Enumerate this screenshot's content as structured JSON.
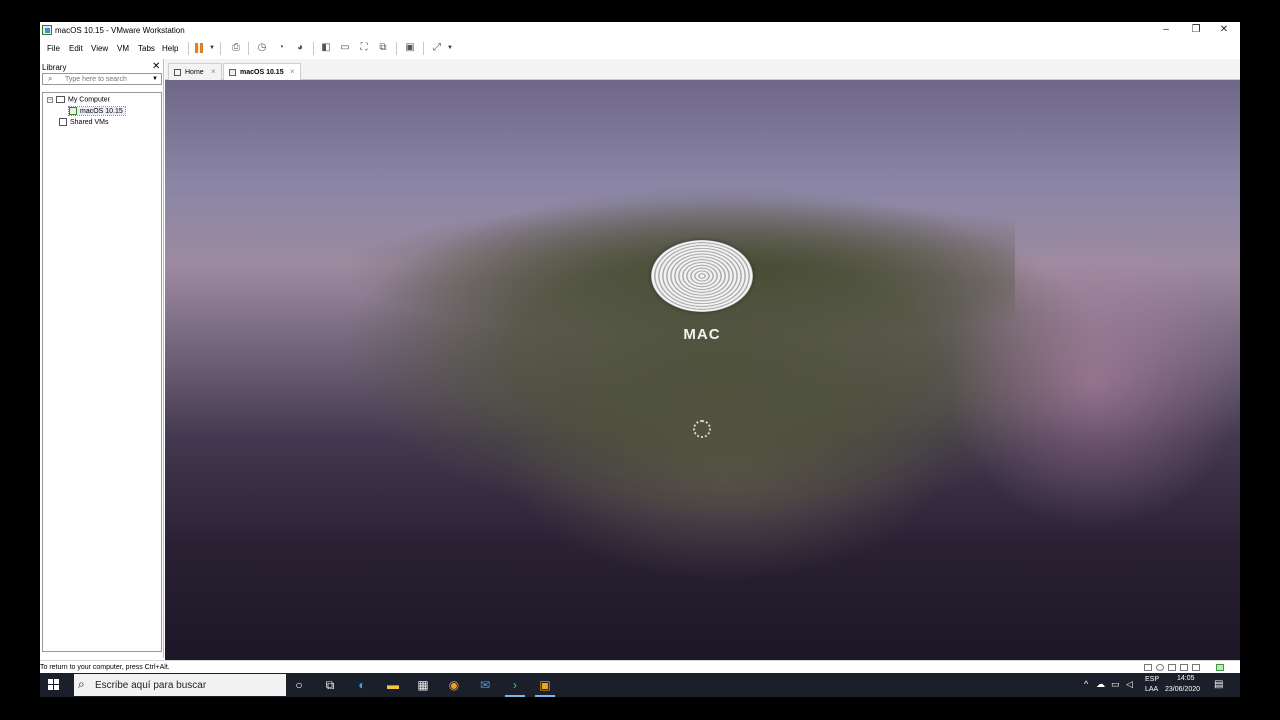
{
  "window": {
    "title": "macOS 10.15 - VMware Workstation",
    "minimize": "–",
    "restore": "❐",
    "close": "✕"
  },
  "menu": {
    "items": [
      "File",
      "Edit",
      "View",
      "VM",
      "Tabs",
      "Help"
    ]
  },
  "library": {
    "title": "Library",
    "close": "✕",
    "search_placeholder": "Type here to search",
    "tree": {
      "my_computer": "My Computer",
      "vm": "macOS 10.15",
      "shared": "Shared VMs"
    }
  },
  "tabs": [
    {
      "label": "Home",
      "close": "×"
    },
    {
      "label": "macOS 10.15",
      "close": "×"
    }
  ],
  "vm_screen": {
    "logo_label": "MAC"
  },
  "statusbar": {
    "text": "To return to your computer, press Ctrl+Alt."
  },
  "taskbar": {
    "search_placeholder": "Escribe aquí para buscar",
    "lang_top": "ESP",
    "lang_bottom": "LAA",
    "time": "14:05",
    "date": "23/06/2020"
  },
  "colors": {
    "taskbar": "#1b1f2a",
    "pause_accent": "#e87b1a",
    "active_underline": "#76b9ed"
  }
}
